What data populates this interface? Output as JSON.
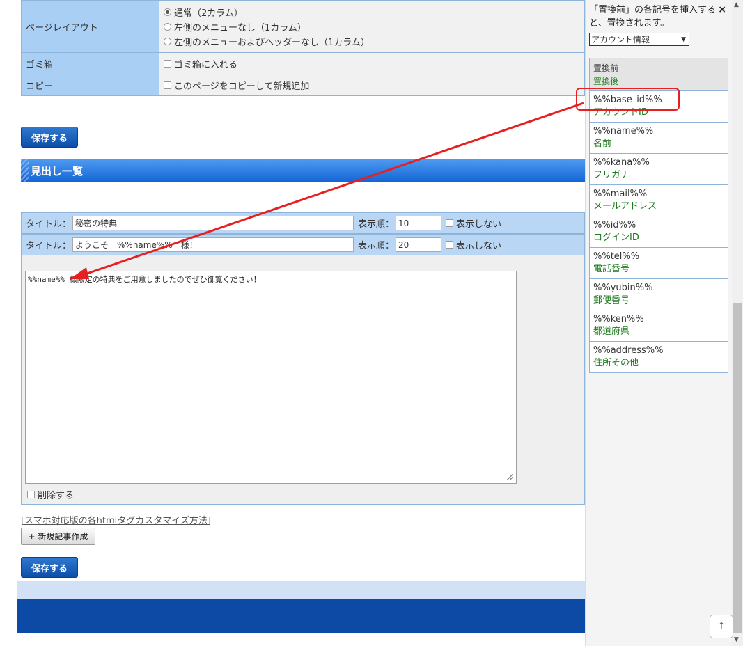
{
  "settings": {
    "page_layout": {
      "label": "ページレイアウト",
      "options": [
        "通常（2カラム）",
        "左側のメニューなし（1カラム）",
        "左側のメニューおよびヘッダーなし（1カラム）"
      ],
      "selected": "通常（2カラム）"
    },
    "trash": {
      "label": "ゴミ箱",
      "checkbox_label": "ゴミ箱に入れる"
    },
    "copy": {
      "label": "コピー",
      "checkbox_label": "このページをコピーして新規追加"
    }
  },
  "save_label": "保存する",
  "section_title": "見出し一覧",
  "headings": [
    {
      "title_label": "タイトル：",
      "title_value": "秘密の特典",
      "order_label": "表示順：",
      "order_value": "10",
      "hide_label": "表示しない"
    },
    {
      "title_label": "タイトル：",
      "title_value": "ようこそ　%%name%%　様！",
      "order_label": "表示順：",
      "order_value": "20",
      "hide_label": "表示しない"
    }
  ],
  "editor": {
    "content": "%%name%% 様限定の特典をご用意しましたのでぜひ御覧ください！",
    "delete_label": "削除する"
  },
  "custom_link": "[スマホ対応版の各htmlタグカスタマイズ方法]",
  "new_article_label": "+ 新規記事作成",
  "panel": {
    "help_text": "「置換前」の各記号を挿入すると、置換されます。",
    "close": "×",
    "select_value": "アカウント情報",
    "header_before": "置換前",
    "header_after": "置換後",
    "items": [
      {
        "code": "%%base_id%%",
        "desc": "アカウントID"
      },
      {
        "code": "%%name%%",
        "desc": "名前"
      },
      {
        "code": "%%kana%%",
        "desc": "フリガナ"
      },
      {
        "code": "%%mail%%",
        "desc": "メールアドレス"
      },
      {
        "code": "%%id%%",
        "desc": "ログインID"
      },
      {
        "code": "%%tel%%",
        "desc": "電話番号"
      },
      {
        "code": "%%yubin%%",
        "desc": "郵便番号"
      },
      {
        "code": "%%ken%%",
        "desc": "都道府県"
      },
      {
        "code": "%%address%%",
        "desc": "住所その他"
      }
    ]
  },
  "colors": {
    "annotation": "#e62020",
    "header_blue": "#1466d6",
    "label_bg": "#a9cff5",
    "desc_green": "#1d7a1d"
  }
}
